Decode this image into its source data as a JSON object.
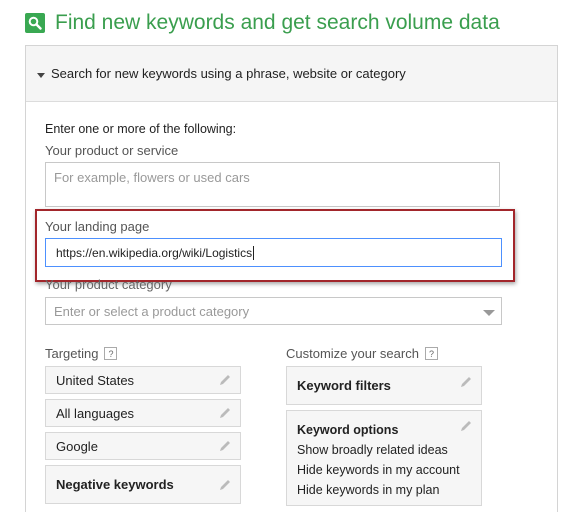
{
  "header": {
    "title": "Find new keywords and get search volume data",
    "icon": "search-icon",
    "accent": "#39a852"
  },
  "panel": {
    "section_label": "Search for new keywords using a phrase, website or category"
  },
  "form": {
    "instruction": "Enter one or more of the following:",
    "product_label": "Your product or service",
    "product_placeholder": "For example, flowers or used cars",
    "landing_label": "Your landing page",
    "landing_value": "https://en.wikipedia.org/wiki/Logistics",
    "category_label": "Your product category",
    "category_placeholder": "Enter or select a product category"
  },
  "targeting": {
    "label": "Targeting",
    "help": "?",
    "items": [
      {
        "label": "United States"
      },
      {
        "label": "All languages"
      },
      {
        "label": "Google"
      },
      {
        "label": "Negative keywords"
      }
    ]
  },
  "customize": {
    "label": "Customize your search",
    "help": "?",
    "filters_label": "Keyword filters",
    "options_title": "Keyword options",
    "options": [
      "Show broadly related ideas",
      "Hide keywords in my account",
      "Hide keywords in my plan"
    ]
  },
  "colors": {
    "title_green": "#3a9e4e",
    "highlight_red": "#a2262b",
    "focus_blue": "#4d90fe"
  }
}
